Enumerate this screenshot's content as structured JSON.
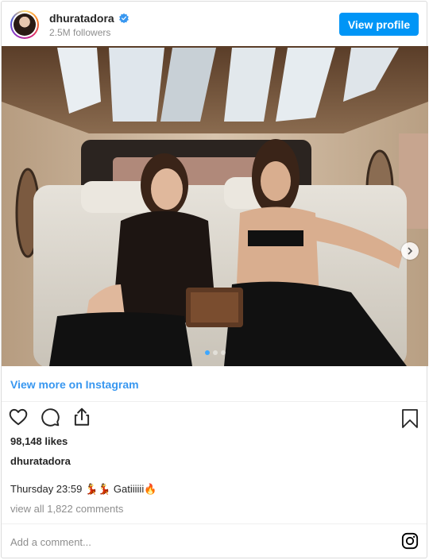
{
  "header": {
    "username": "dhuratadora",
    "followers": "2.5M followers",
    "view_profile_label": "View profile",
    "verified_icon": "verified-badge-icon"
  },
  "post": {
    "image_alt": "",
    "carousel_dots": 3,
    "carousel_active_index": 0
  },
  "view_more_label": "View more on Instagram",
  "actions": {
    "like_icon": "heart-icon",
    "comment_icon": "comment-icon",
    "share_icon": "share-icon",
    "save_icon": "bookmark-icon"
  },
  "likes": "98,148 likes",
  "caption": {
    "username": "dhuratadora",
    "text": "Thursday 23:59 💃💃 Gatiiiiii🔥"
  },
  "comments_link": "view all 1,822 comments",
  "add_comment_placeholder": "Add a comment...",
  "colors": {
    "accent": "#0095f6",
    "link": "#3897f0",
    "muted": "#8e8e8e",
    "text": "#262626"
  }
}
